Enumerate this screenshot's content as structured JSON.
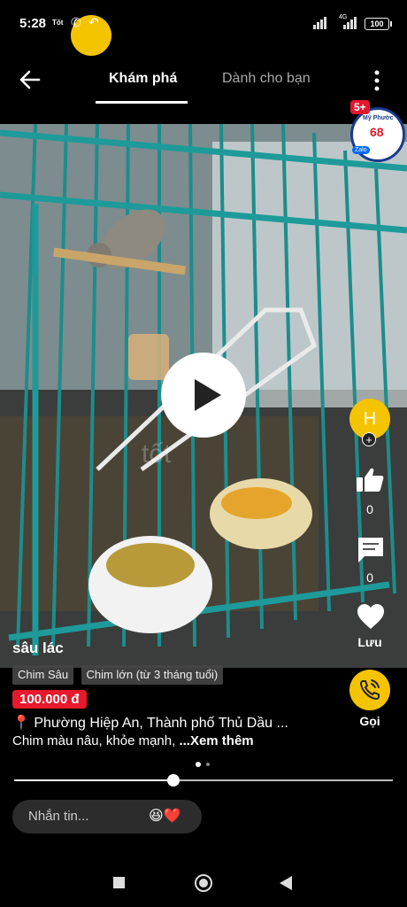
{
  "status_bar": {
    "time": "5:28",
    "carrier": "Tốt",
    "network": "4G",
    "battery": "100"
  },
  "nav": {
    "back_icon": "arrow-left-icon",
    "tabs": [
      {
        "label": "Khám phá",
        "active": true
      },
      {
        "label": "Dành cho bạn",
        "active": false
      }
    ],
    "more_icon": "more-vertical-icon"
  },
  "ad_badge": {
    "corner": "5+",
    "line1": "Mỹ Phước",
    "number": "68",
    "zalo": "Zalo"
  },
  "video": {
    "play_icon": "play-icon",
    "progress": 0.42
  },
  "seller": {
    "initial": "H"
  },
  "actions": {
    "like_count": "0",
    "comment_count": "0",
    "save_label": "Lưu",
    "call_label": "Gọi"
  },
  "listing": {
    "title": "sâu lác",
    "tags": [
      "Chim Sâu",
      "Chim lớn (từ 3 tháng tuổi)"
    ],
    "price": "100.000 đ",
    "location": "Phường Hiệp An, Thành phố Thủ Dầu ...",
    "description": "Chim màu nâu, khỏe mạnh, ",
    "see_more": "...Xem thêm"
  },
  "pager": {
    "current": 1,
    "total": 2
  },
  "message": {
    "placeholder": "Nhắn tin...",
    "emoji": "😆❤️"
  },
  "colors": {
    "accent_yellow": "#f5c400",
    "price_red": "#e8192c",
    "cage_teal": "#1e8c8c"
  }
}
